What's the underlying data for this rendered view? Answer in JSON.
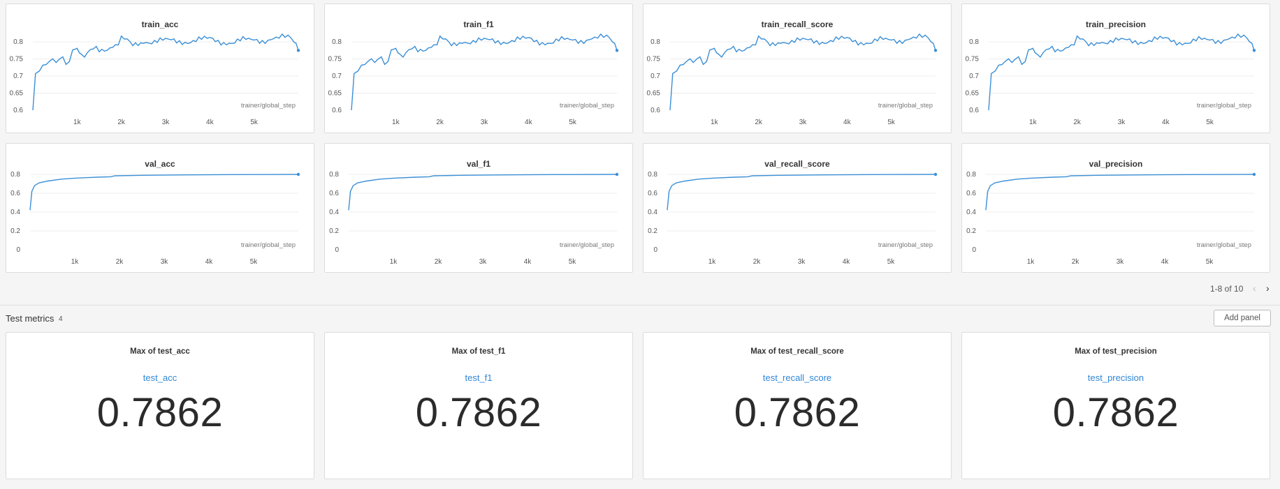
{
  "charts": [
    {
      "title": "train_acc",
      "xlabel": "trainer/global_step",
      "yticks": [
        "0.8",
        "0.75",
        "0.7",
        "0.65",
        "0.6"
      ],
      "xticks": [
        "1k",
        "2k",
        "3k",
        "4k",
        "5k"
      ]
    },
    {
      "title": "train_f1",
      "xlabel": "trainer/global_step",
      "yticks": [
        "0.8",
        "0.75",
        "0.7",
        "0.65",
        "0.6"
      ],
      "xticks": [
        "1k",
        "2k",
        "3k",
        "4k",
        "5k"
      ]
    },
    {
      "title": "train_recall_score",
      "xlabel": "trainer/global_step",
      "yticks": [
        "0.8",
        "0.75",
        "0.7",
        "0.65",
        "0.6"
      ],
      "xticks": [
        "1k",
        "2k",
        "3k",
        "4k",
        "5k"
      ]
    },
    {
      "title": "train_precision",
      "xlabel": "trainer/global_step",
      "yticks": [
        "0.8",
        "0.75",
        "0.7",
        "0.65",
        "0.6"
      ],
      "xticks": [
        "1k",
        "2k",
        "3k",
        "4k",
        "5k"
      ]
    },
    {
      "title": "val_acc",
      "xlabel": "trainer/global_step",
      "yticks": [
        "0.8",
        "0.6",
        "0.4",
        "0.2",
        "0"
      ],
      "xticks": [
        "1k",
        "2k",
        "3k",
        "4k",
        "5k"
      ]
    },
    {
      "title": "val_f1",
      "xlabel": "trainer/global_step",
      "yticks": [
        "0.8",
        "0.6",
        "0.4",
        "0.2",
        "0"
      ],
      "xticks": [
        "1k",
        "2k",
        "3k",
        "4k",
        "5k"
      ]
    },
    {
      "title": "val_recall_score",
      "xlabel": "trainer/global_step",
      "yticks": [
        "0.8",
        "0.6",
        "0.4",
        "0.2",
        "0"
      ],
      "xticks": [
        "1k",
        "2k",
        "3k",
        "4k",
        "5k"
      ]
    },
    {
      "title": "val_precision",
      "xlabel": "trainer/global_step",
      "yticks": [
        "0.8",
        "0.6",
        "0.4",
        "0.2",
        "0"
      ],
      "xticks": [
        "1k",
        "2k",
        "3k",
        "4k",
        "5k"
      ]
    }
  ],
  "chart_data": [
    {
      "type": "line",
      "title": "train_acc",
      "xlabel": "trainer/global_step",
      "ylim": [
        0.6,
        0.8
      ],
      "xlim": [
        0,
        6000
      ],
      "x": [
        0,
        60,
        150,
        300,
        450,
        600,
        750,
        900,
        1000,
        1100,
        1300,
        1500,
        1800,
        2000,
        2200,
        2500,
        3000,
        3500,
        4000,
        4500,
        5000,
        5500,
        5900,
        6000
      ],
      "y": [
        0.6,
        0.72,
        0.71,
        0.74,
        0.745,
        0.75,
        0.74,
        0.765,
        0.78,
        0.765,
        0.775,
        0.775,
        0.79,
        0.81,
        0.795,
        0.805,
        0.8,
        0.805,
        0.805,
        0.8,
        0.805,
        0.81,
        0.81,
        0.775
      ]
    },
    {
      "type": "line",
      "title": "train_f1",
      "xlabel": "trainer/global_step",
      "ylim": [
        0.6,
        0.8
      ],
      "xlim": [
        0,
        6000
      ],
      "x": [
        0,
        60,
        150,
        300,
        450,
        600,
        750,
        900,
        1000,
        1100,
        1300,
        1500,
        1800,
        2000,
        2200,
        2500,
        3000,
        3500,
        4000,
        4500,
        5000,
        5500,
        5900,
        6000
      ],
      "y": [
        0.6,
        0.72,
        0.71,
        0.74,
        0.745,
        0.75,
        0.74,
        0.765,
        0.78,
        0.765,
        0.775,
        0.775,
        0.79,
        0.81,
        0.795,
        0.805,
        0.8,
        0.805,
        0.805,
        0.8,
        0.805,
        0.81,
        0.81,
        0.775
      ]
    },
    {
      "type": "line",
      "title": "train_recall_score",
      "xlabel": "trainer/global_step",
      "ylim": [
        0.6,
        0.8
      ],
      "xlim": [
        0,
        6000
      ],
      "x": [
        0,
        60,
        150,
        300,
        450,
        600,
        750,
        900,
        1000,
        1100,
        1300,
        1500,
        1800,
        2000,
        2200,
        2500,
        3000,
        3500,
        4000,
        4500,
        5000,
        5500,
        5900,
        6000
      ],
      "y": [
        0.6,
        0.72,
        0.71,
        0.74,
        0.745,
        0.75,
        0.74,
        0.765,
        0.78,
        0.765,
        0.775,
        0.775,
        0.79,
        0.81,
        0.795,
        0.805,
        0.8,
        0.805,
        0.805,
        0.8,
        0.805,
        0.81,
        0.81,
        0.775
      ]
    },
    {
      "type": "line",
      "title": "train_precision",
      "xlabel": "trainer/global_step",
      "ylim": [
        0.6,
        0.8
      ],
      "xlim": [
        0,
        6000
      ],
      "x": [
        0,
        60,
        150,
        300,
        450,
        600,
        750,
        900,
        1000,
        1100,
        1300,
        1500,
        1800,
        2000,
        2200,
        2500,
        3000,
        3500,
        4000,
        4500,
        5000,
        5500,
        5900,
        6000
      ],
      "y": [
        0.6,
        0.72,
        0.71,
        0.74,
        0.745,
        0.75,
        0.74,
        0.765,
        0.78,
        0.765,
        0.775,
        0.775,
        0.79,
        0.81,
        0.795,
        0.805,
        0.8,
        0.805,
        0.805,
        0.8,
        0.805,
        0.81,
        0.81,
        0.775
      ]
    },
    {
      "type": "line",
      "title": "val_acc",
      "xlabel": "trainer/global_step",
      "ylim": [
        0,
        0.8
      ],
      "xlim": [
        0,
        6000
      ],
      "x": [
        0,
        40,
        100,
        200,
        400,
        700,
        1000,
        1500,
        1800,
        1900,
        2500,
        3500,
        4500,
        6000
      ],
      "y": [
        0.42,
        0.62,
        0.68,
        0.71,
        0.73,
        0.75,
        0.76,
        0.77,
        0.775,
        0.785,
        0.79,
        0.795,
        0.798,
        0.8
      ]
    },
    {
      "type": "line",
      "title": "val_f1",
      "xlabel": "trainer/global_step",
      "ylim": [
        0,
        0.8
      ],
      "xlim": [
        0,
        6000
      ],
      "x": [
        0,
        40,
        100,
        200,
        400,
        700,
        1000,
        1500,
        1800,
        1900,
        2500,
        3500,
        4500,
        6000
      ],
      "y": [
        0.42,
        0.62,
        0.68,
        0.71,
        0.73,
        0.75,
        0.76,
        0.77,
        0.775,
        0.785,
        0.79,
        0.795,
        0.798,
        0.8
      ]
    },
    {
      "type": "line",
      "title": "val_recall_score",
      "xlabel": "trainer/global_step",
      "ylim": [
        0,
        0.8
      ],
      "xlim": [
        0,
        6000
      ],
      "x": [
        0,
        40,
        100,
        200,
        400,
        700,
        1000,
        1500,
        1800,
        1900,
        2500,
        3500,
        4500,
        6000
      ],
      "y": [
        0.42,
        0.62,
        0.68,
        0.71,
        0.73,
        0.75,
        0.76,
        0.77,
        0.775,
        0.785,
        0.79,
        0.795,
        0.798,
        0.8
      ]
    },
    {
      "type": "line",
      "title": "val_precision",
      "xlabel": "trainer/global_step",
      "ylim": [
        0,
        0.8
      ],
      "xlim": [
        0,
        6000
      ],
      "x": [
        0,
        40,
        100,
        200,
        400,
        700,
        1000,
        1500,
        1800,
        1900,
        2500,
        3500,
        4500,
        6000
      ],
      "y": [
        0.42,
        0.62,
        0.68,
        0.71,
        0.73,
        0.75,
        0.76,
        0.77,
        0.775,
        0.785,
        0.79,
        0.795,
        0.798,
        0.8
      ]
    }
  ],
  "pager": {
    "text": "1-8 of 10",
    "prev_icon": "chevron-left-icon",
    "next_icon": "chevron-right-icon"
  },
  "section": {
    "title": "Test metrics",
    "count": "4",
    "add_panel_label": "Add panel"
  },
  "metrics": [
    {
      "title": "Max of test_acc",
      "link": "test_acc",
      "value": "0.7862"
    },
    {
      "title": "Max of test_f1",
      "link": "test_f1",
      "value": "0.7862"
    },
    {
      "title": "Max of test_recall_score",
      "link": "test_recall_score",
      "value": "0.7862"
    },
    {
      "title": "Max of test_precision",
      "link": "test_precision",
      "value": "0.7862"
    }
  ],
  "colors": {
    "series": "#3b8fd6",
    "link": "#2f86d6"
  }
}
